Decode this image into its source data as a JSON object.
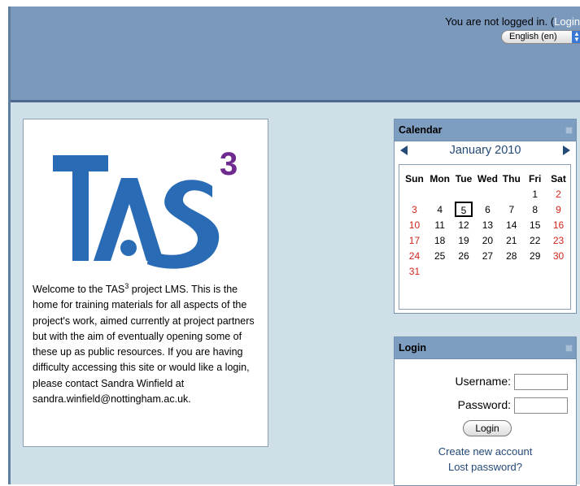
{
  "header": {
    "login_status": "You are not logged in. (",
    "login_link": "Login",
    "language": "English (en)"
  },
  "welcome": {
    "logo_text": "TAS",
    "logo_superscript": "3",
    "intro_before": "Welcome to the TAS",
    "intro_sup": "3",
    "intro_after": " project LMS. This is the home for training materials for all aspects of the project's work, aimed currently at project partners but with the aim of eventually opening some of these up as public resources. If you are having difficulty accessing this site or would like a login, please contact Sandra Winfield at sandra.winfield@nottingham.ac.uk."
  },
  "calendar": {
    "title": "Calendar",
    "month": "January 2010",
    "weekdays": [
      "Sun",
      "Mon",
      "Tue",
      "Wed",
      "Thu",
      "Fri",
      "Sat"
    ],
    "weeks": [
      [
        "",
        "",
        "",
        "",
        "",
        "1",
        "2"
      ],
      [
        "3",
        "4",
        "5",
        "6",
        "7",
        "8",
        "9"
      ],
      [
        "10",
        "11",
        "12",
        "13",
        "14",
        "15",
        "16"
      ],
      [
        "17",
        "18",
        "19",
        "20",
        "21",
        "22",
        "23"
      ],
      [
        "24",
        "25",
        "26",
        "27",
        "28",
        "29",
        "30"
      ],
      [
        "31",
        "",
        "",
        "",
        "",
        "",
        ""
      ]
    ],
    "today": "5",
    "weekend_color": "#d0261b"
  },
  "login": {
    "title": "Login",
    "username_label": "Username:",
    "password_label": "Password:",
    "button": "Login",
    "create_account": "Create new account",
    "lost_password": "Lost password?"
  },
  "colors": {
    "header_bg": "#7a99bd",
    "page_bg": "#cfdfe8",
    "block_header": "#7e9ec1",
    "link": "#244a77",
    "logo_blue": "#2a6bb5",
    "logo_purple": "#6f2a8f"
  }
}
